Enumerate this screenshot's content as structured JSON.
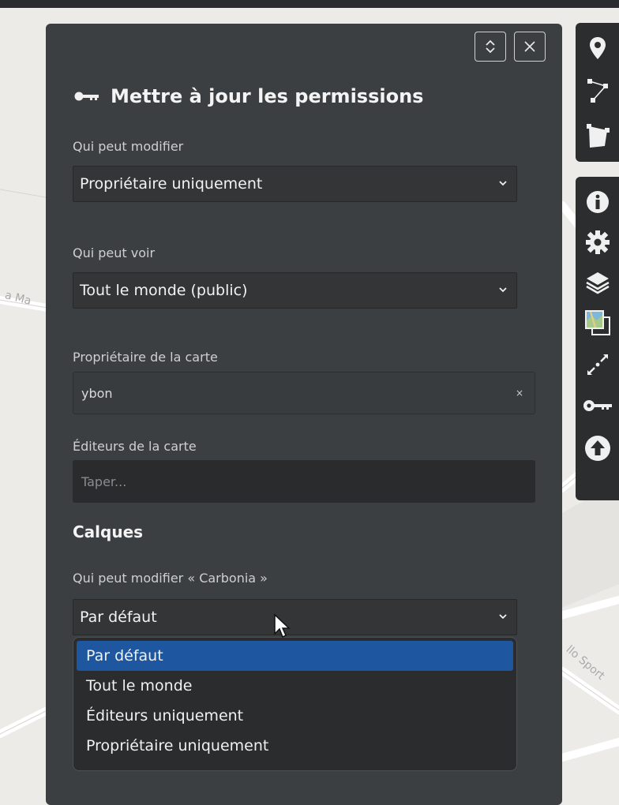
{
  "panel": {
    "title": "Mettre à jour les permissions",
    "expand_button": "expand-icon",
    "close_button": "close-icon",
    "fields": {
      "edit_label": "Qui peut modifier",
      "edit_value": "Propriétaire uniquement",
      "view_label": "Qui peut voir",
      "view_value": "Tout le monde (public)",
      "owner_label": "Propriétaire de la carte",
      "owner_value": "ybon",
      "owner_clear": "×",
      "editors_label": "Éditeurs de la carte",
      "editors_placeholder": "Taper..."
    },
    "layers": {
      "heading": "Calques",
      "layer_label": "Qui peut modifier « Carbonia »",
      "layer_value": "Par défaut",
      "options": [
        {
          "label": "Par défaut",
          "selected": true
        },
        {
          "label": "Tout le monde",
          "selected": false
        },
        {
          "label": "Éditeurs uniquement",
          "selected": false
        },
        {
          "label": "Propriétaire uniquement",
          "selected": false
        }
      ]
    }
  },
  "map_labels": [
    "a Ma",
    "llo Sport"
  ],
  "toolbar_top": [
    "marker-icon",
    "polyline-icon",
    "polygon-icon"
  ],
  "toolbar_bottom": [
    "info-icon",
    "settings-icon",
    "layers-icon",
    "tilelayer-icon",
    "center-icon",
    "permissions-icon",
    "upload-icon"
  ],
  "colors": {
    "panel_bg": "#3c3f41",
    "toolbar_bg": "#2b2d2e",
    "selected_option": "#1e56a0",
    "map_bg": "#ecebe8"
  }
}
